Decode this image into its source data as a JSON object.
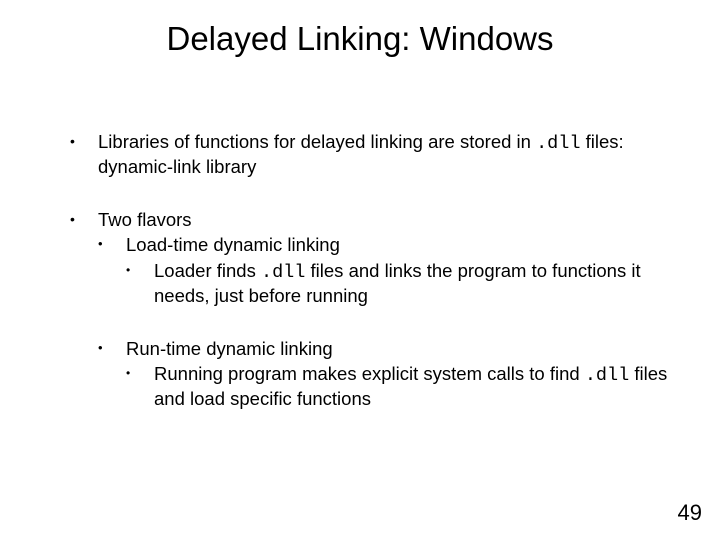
{
  "title": "Delayed Linking: Windows",
  "bullets": {
    "b1a_pre": "Libraries of functions for delayed linking are stored in ",
    "b1a_code": ".dll",
    "b1a_post": " files: dynamic-link library",
    "b2": "Two flavors",
    "b2a": "Load-time dynamic linking",
    "b2a1_pre": "Loader finds ",
    "b2a1_code": ".dll",
    "b2a1_post": " files and links the program to functions it needs, just before running",
    "b2b": "Run-time dynamic linking",
    "b2b1_pre": "Running program makes explicit system calls to find ",
    "b2b1_code": ".dll",
    "b2b1_post": " files and load specific functions"
  },
  "page_number": "49",
  "bullet_char": "•"
}
